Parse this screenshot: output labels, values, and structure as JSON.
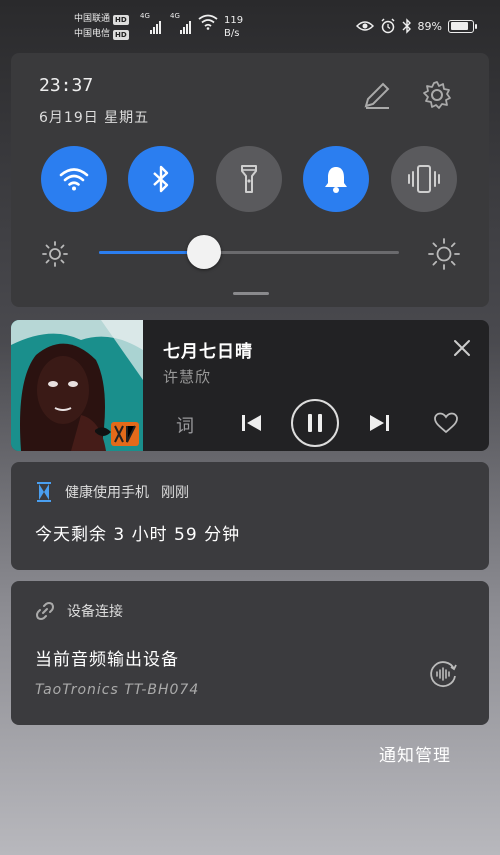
{
  "status_bar": {
    "carrier1": "中国联通",
    "carrier2": "中国电信",
    "hd": "HD",
    "network": "4G",
    "speed_value": "119",
    "speed_unit": "B/s",
    "battery_percent": 89,
    "battery_label": "89%"
  },
  "quick_settings": {
    "time": "23:37",
    "date": "6月19日 星期五",
    "toggles": [
      {
        "name": "wifi",
        "state": "on"
      },
      {
        "name": "bluetooth",
        "state": "on"
      },
      {
        "name": "flashlight",
        "state": "off"
      },
      {
        "name": "sound",
        "state": "on"
      },
      {
        "name": "vibrate",
        "state": "off"
      }
    ],
    "brightness": 0.35,
    "colors": {
      "accent": "#2b7ef0",
      "off": "#5a5a5d"
    }
  },
  "media": {
    "title": "七月七日晴",
    "artist": "许慧欣",
    "lyrics_label": "词"
  },
  "notifications": {
    "health": {
      "app": "健康使用手机",
      "time": "刚刚",
      "body": "今天剩余 3 小时 59 分钟"
    },
    "device": {
      "app": "设备连接",
      "body": "当前音频输出设备",
      "sub": "TaoTronics TT-BH074"
    }
  },
  "footer": {
    "manage_label": "通知管理"
  }
}
